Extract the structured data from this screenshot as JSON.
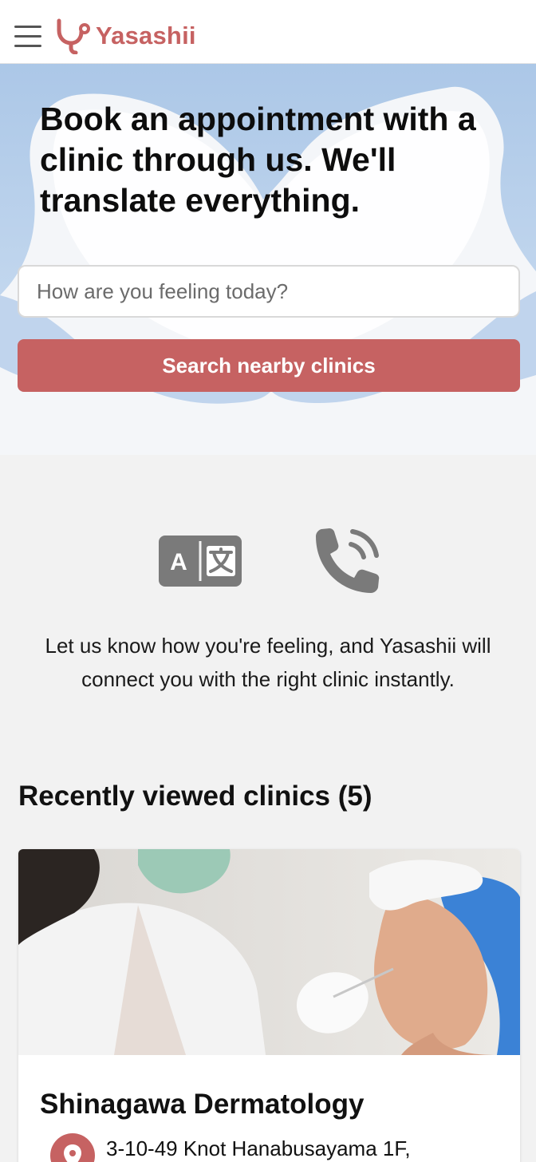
{
  "header": {
    "menu_icon": "hamburger-icon",
    "logo_icon": "stethoscope-icon",
    "logo_text": "Yasashii",
    "brand_color": "#c66262"
  },
  "hero": {
    "title": "Book an appointment with a clinic through us. We'll translate everything.",
    "search_placeholder": "How are you feeling today?",
    "search_button_label": "Search nearby clinics",
    "background_image": "hands forming heart shape in blue medical gloves"
  },
  "features": {
    "icons": [
      "translate-icon",
      "phone-call-icon"
    ],
    "text": "Let us know how you're feeling, and Yasashii will connect you with the right clinic instantly."
  },
  "recent": {
    "heading": "Recently viewed clinics (5)",
    "clinics": [
      {
        "name": "Shinagawa Dermatology",
        "address": "3-10-49 Knot Hanabusayama 1F,",
        "pin_icon": "location-pin-icon"
      }
    ]
  },
  "colors": {
    "accent": "#c66262",
    "icon_gray": "#7a7a7a",
    "page_background": "#f2f2f2"
  }
}
